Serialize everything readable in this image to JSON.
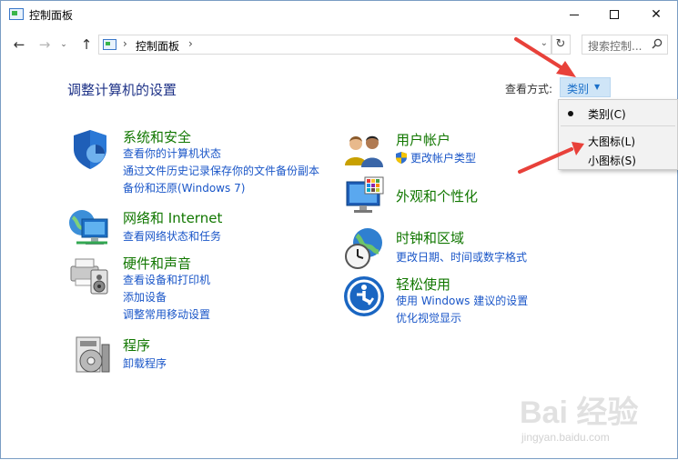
{
  "window": {
    "title": "控制面板",
    "controls": {
      "minimize": "minimize",
      "maximize": "maximize",
      "close": "✕"
    }
  },
  "nav": {
    "back": "←",
    "forward": "→",
    "recent": "⌄",
    "up": "↑"
  },
  "address": {
    "sep": "›",
    "path": "控制面板",
    "sep2": "›",
    "dropdown": "⌄",
    "refresh": "↻"
  },
  "search": {
    "placeholder": "搜索控制...",
    "icon": "search-icon"
  },
  "header": {
    "title": "调整计算机的设置",
    "view_label": "查看方式:",
    "view_value": "类别",
    "view_caret": "▼"
  },
  "view_menu": {
    "items": [
      {
        "label": "类别(C)",
        "selected": true
      },
      {
        "label": "大图标(L)",
        "selected": false
      },
      {
        "label": "小图标(S)",
        "selected": false
      }
    ]
  },
  "categories": {
    "system_security": {
      "title": "系统和安全",
      "links": [
        "查看你的计算机状态",
        "通过文件历史记录保存你的文件备份副本",
        "备份和还原(Windows 7)"
      ]
    },
    "network": {
      "title": "网络和 Internet",
      "links": [
        "查看网络状态和任务"
      ]
    },
    "hardware": {
      "title": "硬件和声音",
      "links": [
        "查看设备和打印机",
        "添加设备",
        "调整常用移动设置"
      ]
    },
    "programs": {
      "title": "程序",
      "links": [
        "卸载程序"
      ]
    },
    "user_accounts": {
      "title": "用户帐户",
      "links": [
        "更改帐户类型"
      ]
    },
    "appearance": {
      "title": "外观和个性化",
      "links": []
    },
    "clock_region": {
      "title": "时钟和区域",
      "links": [
        "更改日期、时间或数字格式"
      ]
    },
    "ease_access": {
      "title": "轻松使用",
      "links": [
        "使用 Windows 建议的设置",
        "优化视觉显示"
      ]
    }
  },
  "watermark": {
    "text": "Bai 经验",
    "sub": "jingyan.baidu.com"
  },
  "colors": {
    "category_title": "#117700",
    "link": "#1a56c8",
    "heading": "#1e3287",
    "annotation_arrow": "#e8413a"
  }
}
